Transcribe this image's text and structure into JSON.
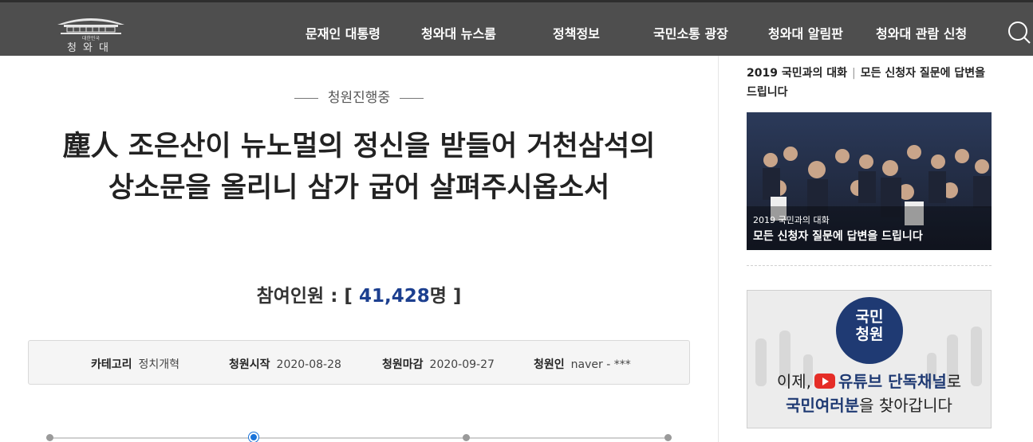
{
  "header": {
    "logo_small": "대한민국",
    "logo_text": "청와대",
    "nav": [
      {
        "label": "문재인 대통령"
      },
      {
        "label": "청와대 뉴스룸"
      },
      {
        "label": "정책정보"
      },
      {
        "label": "국민소통 광장"
      },
      {
        "label": "청와대 알림판"
      },
      {
        "label": "청와대 관람 신청"
      }
    ],
    "search_icon": "search-icon"
  },
  "petition": {
    "status": "청원진행중",
    "title": "塵人 조은산이 뉴노멀의 정신을 받들어 거천삼석의 상소문을 올리니 삼가 굽어 살펴주시옵소서",
    "count_label": "참여인원 : [",
    "count_value": "41,428",
    "count_unit": "명 ]",
    "info": {
      "category_label": "카테고리",
      "category_value": "정치개혁",
      "start_label": "청원시작",
      "start_value": "2020-08-28",
      "end_label": "청원마감",
      "end_value": "2020-09-27",
      "author_label": "청원인",
      "author_value": "naver - ***"
    },
    "progress": {
      "steps": 4,
      "active_step": 2
    }
  },
  "sidebar": {
    "title_part1": "2019 국민과의 대화",
    "title_sep": "|",
    "title_part2": "모든 신청자 질문에 답변을 드립니다",
    "banner1_caption_small": "2019 국민과의 대화",
    "banner1_caption_large": "모든 신청자 질문에 답변을 드립니다",
    "banner2_badge_line1": "국민",
    "banner2_badge_line2": "청원",
    "banner2_line1_pre": "이제,",
    "banner2_line1_strong": "유튜브 단독채널",
    "banner2_line1_post": "로",
    "banner2_line2_strong": "국민여러분",
    "banner2_line2_post": "을 찾아갑니다"
  },
  "colors": {
    "header_bg": "#4e4e4e",
    "accent_blue": "#1c3f8f",
    "progress_active": "#1a73d9",
    "youtube_red": "#e52d27"
  }
}
